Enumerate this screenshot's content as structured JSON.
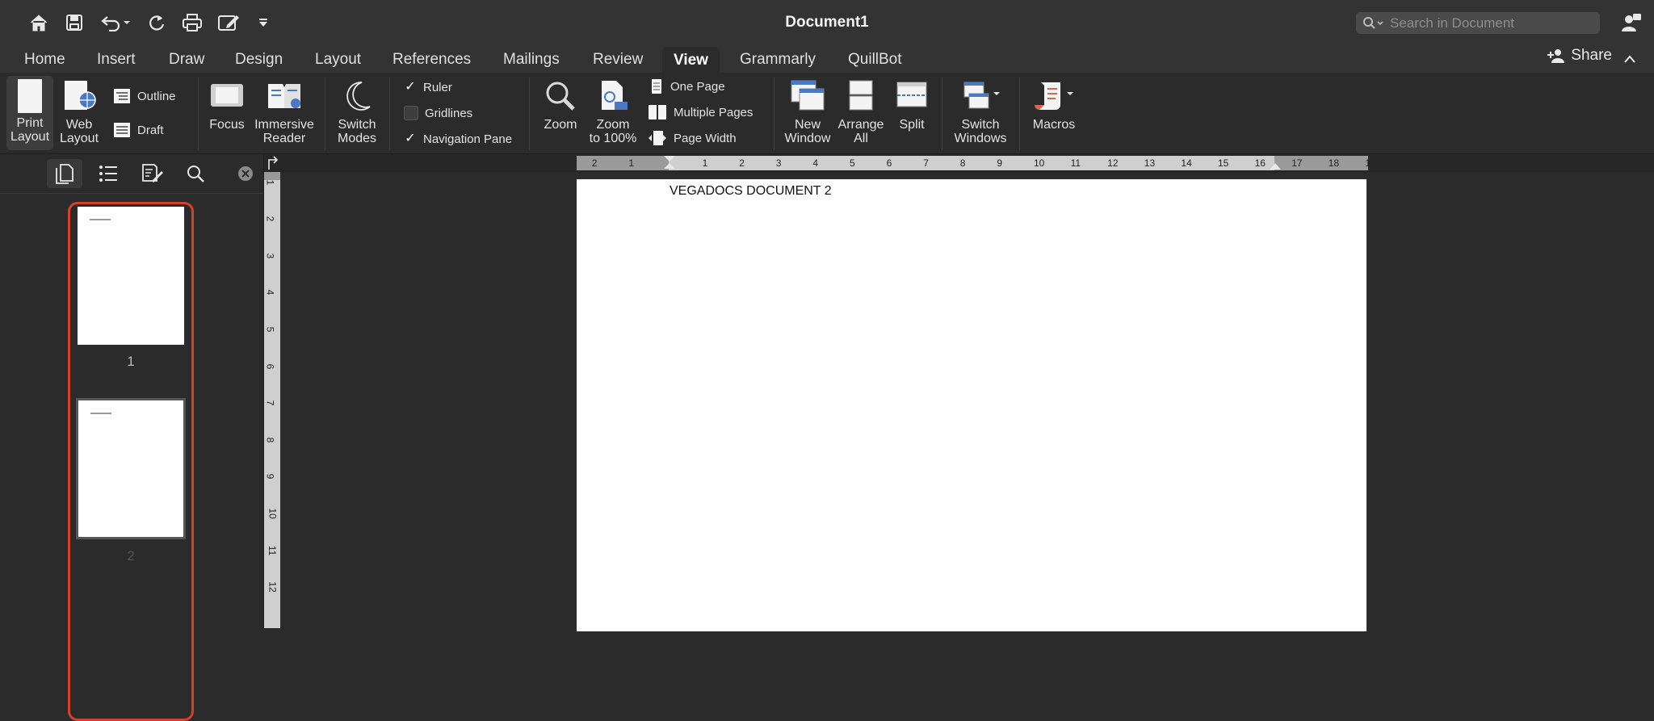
{
  "window": {
    "title": "Document1"
  },
  "search": {
    "placeholder": "Search in Document"
  },
  "tabs": [
    "Home",
    "Insert",
    "Draw",
    "Design",
    "Layout",
    "References",
    "Mailings",
    "Review",
    "View",
    "Grammarly",
    "QuillBot"
  ],
  "active_tab": "View",
  "share_label": "Share",
  "ribbon": {
    "print_layout": [
      "Print",
      "Layout"
    ],
    "web_layout": [
      "Web",
      "Layout"
    ],
    "outline": "Outline",
    "draft": "Draft",
    "focus": "Focus",
    "immersive_reader": [
      "Immersive",
      "Reader"
    ],
    "switch_modes": [
      "Switch",
      "Modes"
    ],
    "ruler": "Ruler",
    "gridlines": "Gridlines",
    "navigation_pane": "Navigation Pane",
    "zoom": "Zoom",
    "zoom_100": [
      "Zoom",
      "to 100%"
    ],
    "one_page": "One Page",
    "multiple_pages": "Multiple Pages",
    "page_width": "Page Width",
    "new_window": [
      "New",
      "Window"
    ],
    "arrange_all": [
      "Arrange",
      "All"
    ],
    "split": "Split",
    "switch_windows": [
      "Switch",
      "Windows"
    ],
    "macros": "Macros"
  },
  "checks": {
    "ruler": true,
    "gridlines": false,
    "navigation_pane": true
  },
  "thumbnails": [
    {
      "label": "1"
    },
    {
      "label": "2"
    }
  ],
  "ruler_numbers": [
    "2",
    "1",
    "1",
    "2",
    "3",
    "4",
    "5",
    "6",
    "7",
    "8",
    "9",
    "10",
    "11",
    "12",
    "13",
    "14",
    "15",
    "16",
    "17",
    "18",
    "1"
  ],
  "vruler_numbers": [
    "1",
    "2",
    "3",
    "4",
    "5",
    "6",
    "7",
    "8",
    "9",
    "10",
    "11",
    "12"
  ],
  "document": {
    "text": "VEGADOCS DOCUMENT 2"
  },
  "colors": {
    "accent_selection": "#d7402a",
    "chrome": "#333333",
    "background": "#2b2b2b"
  }
}
